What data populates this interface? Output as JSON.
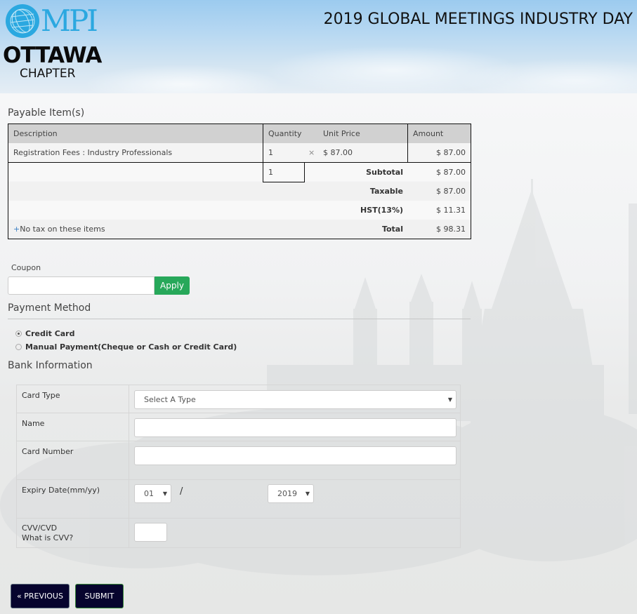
{
  "header": {
    "logo": {
      "brand_text": "MPI",
      "chapter_name": "OTTAWA",
      "chapter_suffix": "CHAPTER",
      "icon": "globe-icon"
    },
    "event_title": "2019 GLOBAL MEETINGS INDUSTRY DAY"
  },
  "payable": {
    "section_title": "Payable Item(s)",
    "columns": {
      "description": "Description",
      "quantity": "Quantity",
      "unit_price": "Unit Price",
      "amount": "Amount"
    },
    "items": [
      {
        "description": "Registration Fees : Industry Professionals",
        "quantity": "1",
        "multiply_symbol": "×",
        "unit_price": "$ 87.00",
        "amount": "$ 87.00"
      }
    ],
    "total_quantity": "1",
    "summary": [
      {
        "label": "Subtotal",
        "value": "$ 87.00"
      },
      {
        "label": "Taxable",
        "value": "$ 87.00"
      },
      {
        "label": "HST(13%)",
        "value": "$ 11.31"
      },
      {
        "label": "Total",
        "value": "$ 98.31"
      }
    ],
    "tax_note_symbol": "+",
    "tax_note": "No tax on these items"
  },
  "coupon": {
    "label": "Coupon",
    "value": "",
    "apply_label": "Apply",
    "apply_color": "#27a85a"
  },
  "payment_method": {
    "section_title": "Payment Method",
    "options": [
      {
        "label": "Credit Card",
        "checked": true
      },
      {
        "label": "Manual Payment(Cheque or Cash or Credit Card)",
        "checked": false
      }
    ]
  },
  "bank": {
    "section_title": "Bank Information",
    "card_type": {
      "label": "Card Type",
      "selected": "Select A Type"
    },
    "name": {
      "label": "Name",
      "value": ""
    },
    "card_number": {
      "label": "Card Number",
      "value": ""
    },
    "expiry": {
      "label": "Expiry Date(mm/yy)",
      "month": "01",
      "separator": "/",
      "year": "2019"
    },
    "cvv": {
      "label": "CVV/CVD",
      "help_link": "What is CVV?",
      "value": ""
    }
  },
  "buttons": {
    "previous": "« PREVIOUS",
    "submit": "SUBMIT",
    "color": "#07042e"
  }
}
